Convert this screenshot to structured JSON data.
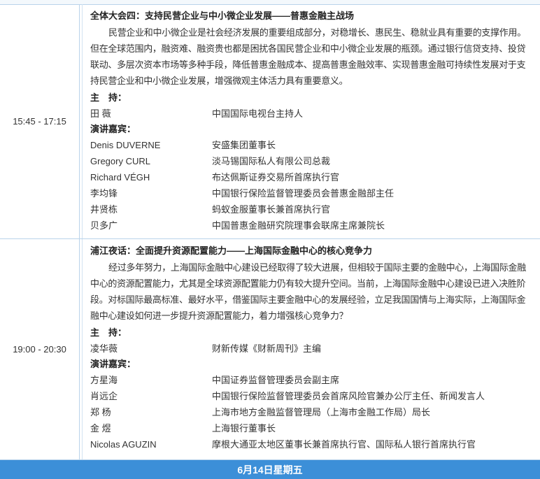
{
  "sessions": [
    {
      "time": "15:45 - 17:15",
      "title": "全体大会四：支持民营企业与中小微企业发展——普惠金融主战场",
      "description": "民营企业和中小微企业是社会经济发展的重要组成部分，对稳增长、惠民生、稳就业具有重要的支撑作用。但在全球范围内，融资难、融资贵也都是困扰各国民营企业和中小微企业发展的瓶颈。通过银行信贷支持、投贷联动、多层次资本市场等多种手段，降低普惠金融成本、提高普惠金融效率、实现普惠金融可持续性发展对于支持民营企业和中小微企业发展，增强微观主体活力具有重要意义。",
      "host_label": "主　持：",
      "hosts": [
        {
          "name": "田 薇",
          "role": "中国国际电视台主持人"
        }
      ],
      "speakers_label": "演讲嘉宾：",
      "speakers": [
        {
          "name": "Denis DUVERNE",
          "role": "安盛集团董事长"
        },
        {
          "name": "Gregory CURL",
          "role": "淡马锡国际私人有限公司总裁"
        },
        {
          "name": "Richard VÉGH",
          "role": "布达佩斯证券交易所首席执行官"
        },
        {
          "name": "李均锋",
          "role": "中国银行保险监督管理委员会普惠金融部主任"
        },
        {
          "name": "井贤栋",
          "role": "蚂蚁金服董事长兼首席执行官"
        },
        {
          "name": "贝多广",
          "role": "中国普惠金融研究院理事会联席主席兼院长"
        }
      ]
    },
    {
      "time": "19:00 - 20:30",
      "title": "浦江夜话：全面提升资源配置能力——上海国际金融中心的核心竞争力",
      "description": "经过多年努力，上海国际金融中心建设已经取得了较大进展，但相较于国际主要的金融中心，上海国际金融中心的资源配置能力，尤其是全球资源配置能力仍有较大提升空间。当前，上海国际金融中心建设已进入决胜阶段。对标国际最高标准、最好水平，借鉴国际主要金融中心的发展经验，立足我国国情与上海实际，上海国际金融中心建设如何进一步提升资源配置能力，着力增强核心竞争力？",
      "host_label": "主　持：",
      "hosts": [
        {
          "name": "凌华薇",
          "role": "财新传媒《财新周刊》主编"
        }
      ],
      "speakers_label": "演讲嘉宾：",
      "speakers": [
        {
          "name": "方星海",
          "role": "中国证券监督管理委员会副主席"
        },
        {
          "name": "肖远企",
          "role": "中国银行保险监督管理委员会首席风险官兼办公厅主任、新闻发言人"
        },
        {
          "name": "郑 杨",
          "role": "上海市地方金融监督管理局（上海市金融工作局）局长"
        },
        {
          "name": "金 煜",
          "role": "上海银行董事长"
        },
        {
          "name": "Nicolas AGUZIN",
          "role": "摩根大通亚太地区董事长兼首席执行官、国际私人银行首席执行官"
        }
      ]
    }
  ],
  "footer": {
    "date": "6月14日星期五"
  }
}
